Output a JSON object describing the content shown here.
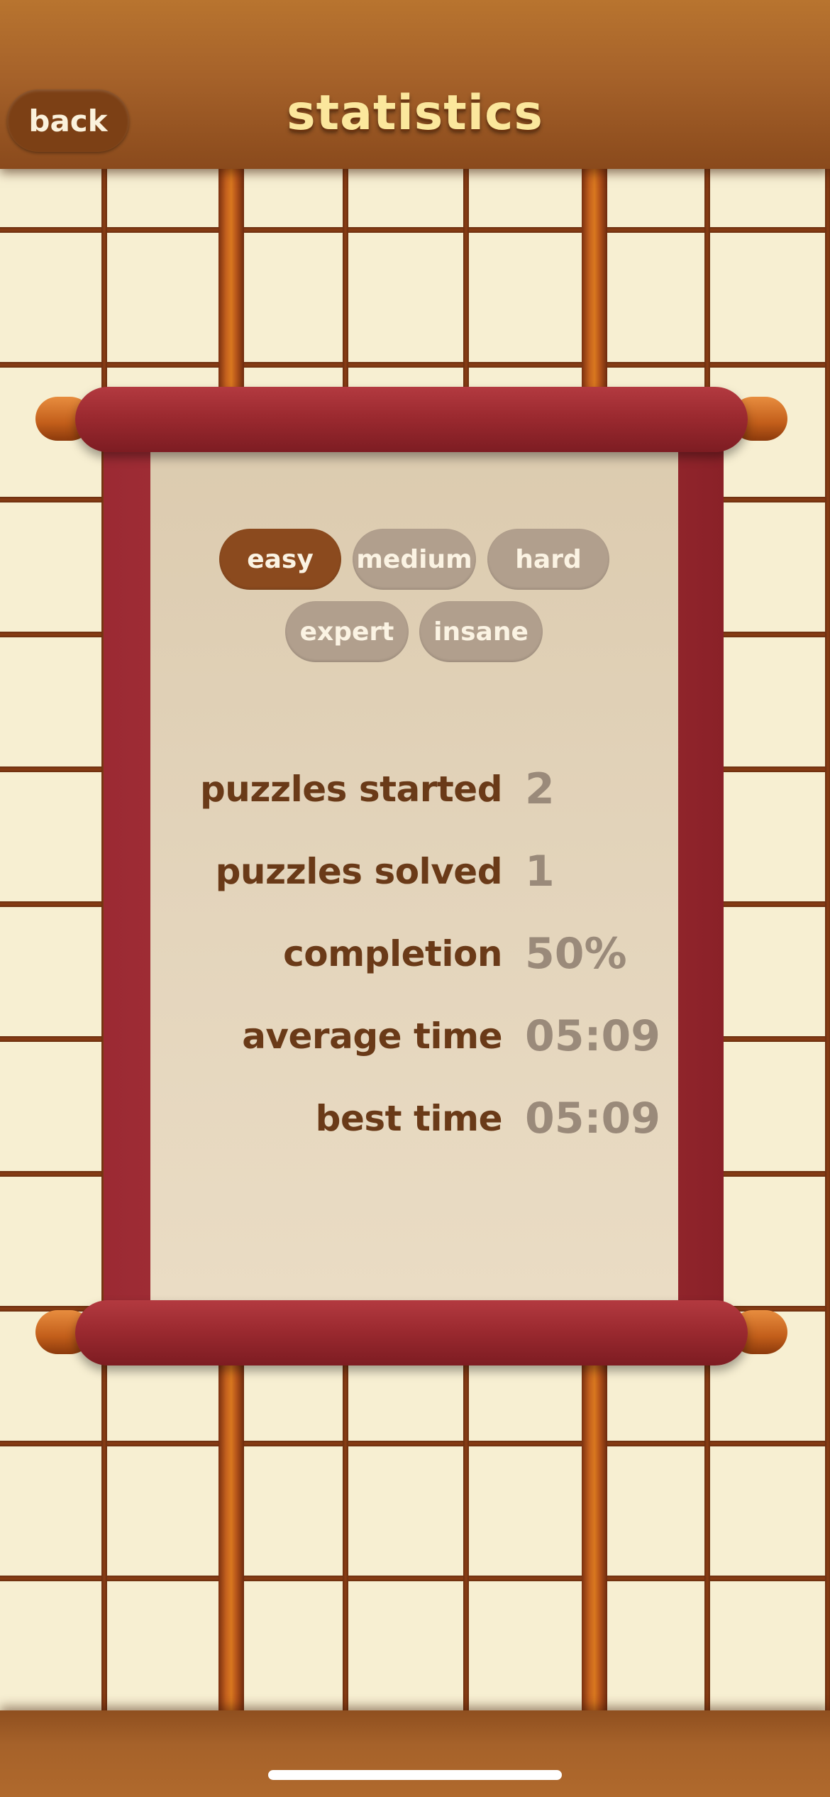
{
  "header": {
    "back_label": "back",
    "title": "statistics"
  },
  "difficulties": [
    {
      "label": "easy",
      "selected": true
    },
    {
      "label": "medium",
      "selected": false
    },
    {
      "label": "hard",
      "selected": false
    },
    {
      "label": "expert",
      "selected": false
    },
    {
      "label": "insane",
      "selected": false
    }
  ],
  "stats": [
    {
      "label": "puzzles started",
      "value": "2"
    },
    {
      "label": "puzzles solved",
      "value": "1"
    },
    {
      "label": "completion",
      "value": "50%"
    },
    {
      "label": "average time",
      "value": "05:09"
    },
    {
      "label": "best time",
      "value": "05:09"
    }
  ],
  "colors": {
    "selected_pill": "#8b4a1e",
    "pill": "#b19f8d",
    "title": "#fbe79c",
    "scroll_red": "#9c2a30"
  }
}
